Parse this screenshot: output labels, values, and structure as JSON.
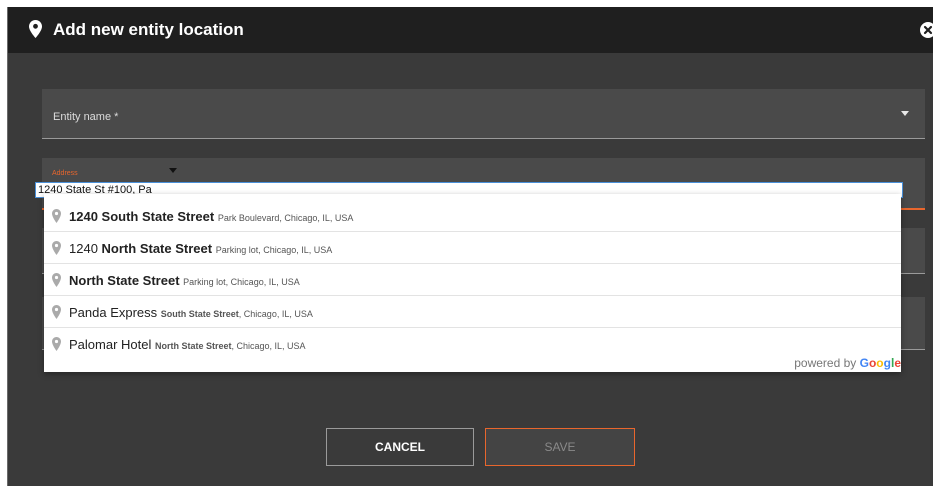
{
  "dialog": {
    "title": "Add new entity location",
    "entity_name_label": "Entity name *",
    "address_label": "Address",
    "address_value": "1240 State St #100, Pa",
    "cancel_label": "CANCEL",
    "save_label": "SAVE"
  },
  "suggestions": [
    {
      "main_bold": "1240 South State Street",
      "main_pre": "",
      "main_post": "",
      "secondary": "Park Boulevard, Chicago, IL, USA"
    },
    {
      "main_pre": "1240 ",
      "main_bold": "North State Street",
      "main_post": "",
      "secondary": "Parking lot, Chicago, IL, USA"
    },
    {
      "main_pre": "",
      "main_bold": "North State Street",
      "main_post": "",
      "secondary": "Parking lot, Chicago, IL, USA"
    },
    {
      "main_pre": "Panda Express ",
      "main_bold": "",
      "main_post": "",
      "secondary_bold": "South State Street",
      "secondary": ", Chicago, IL, USA"
    },
    {
      "main_pre": "Palomar Hotel ",
      "main_bold": "",
      "main_post": "",
      "secondary_bold": "North State Street",
      "secondary": ", Chicago, IL, USA"
    }
  ],
  "powered_by": {
    "prefix": "powered by ",
    "brand": "Google"
  },
  "colors": {
    "accent": "#e8662d",
    "background": "#3a3a3a",
    "header": "#1f1f1f"
  }
}
